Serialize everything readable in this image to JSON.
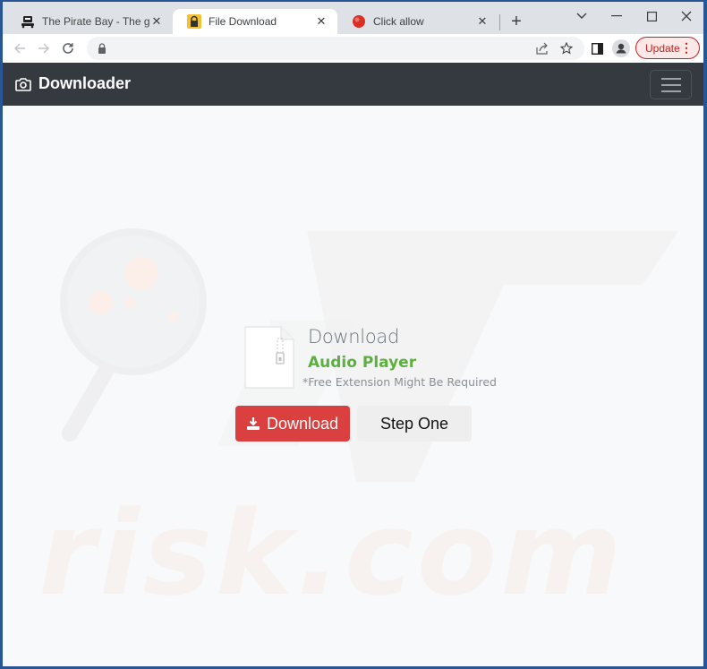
{
  "browser": {
    "tabs": [
      {
        "title": "The Pirate Bay - The galaxy's most resilient BitTorrent site",
        "favicon": "pirate-ship-icon",
        "active": false
      },
      {
        "title": "File Download",
        "favicon": "lock-icon",
        "active": true
      },
      {
        "title": "Click allow",
        "favicon": "red-circle-icon",
        "active": false
      }
    ],
    "new_tab_label": "+",
    "update_label": "Update",
    "address": ""
  },
  "navbar": {
    "brand": "Downloader",
    "brand_icon": "camera-icon",
    "menu_icon": "hamburger-icon"
  },
  "main": {
    "heading": "Download",
    "file_name": "Audio Player",
    "note": "*Free Extension Might Be Required",
    "download_button": "Download",
    "step_button": "Step One"
  },
  "watermark": {
    "text": "risk.com"
  },
  "colors": {
    "navbar": "#343a40",
    "download_button": "#d9403f",
    "file_name": "#5cb03f",
    "update_accent": "#c5221f"
  }
}
